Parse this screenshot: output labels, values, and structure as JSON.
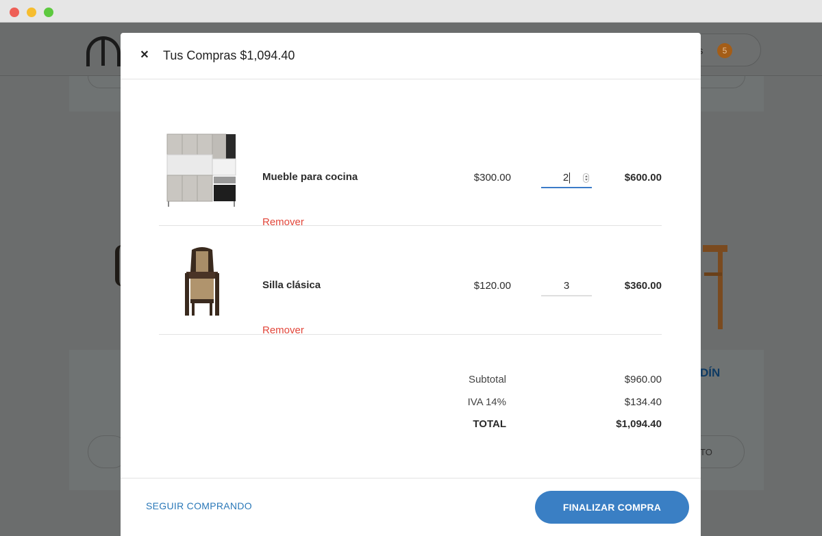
{
  "background": {
    "cart_label_tail": "s",
    "cart_count": "5",
    "section_heading_tail": "DÍN",
    "button_tail": "TO"
  },
  "cart": {
    "title": "Tus Compras",
    "title_total": "$1,094.40",
    "items": [
      {
        "name": "Mueble para cocina",
        "remove_label": "Remover",
        "unit_price": "$300.00",
        "quantity": "2",
        "line_total": "$600.00"
      },
      {
        "name": "Silla clásica",
        "remove_label": "Remover",
        "unit_price": "$120.00",
        "quantity": "3",
        "line_total": "$360.00"
      }
    ],
    "summary": {
      "subtotal_label": "Subtotal",
      "subtotal_value": "$960.00",
      "tax_label": "IVA 14%",
      "tax_value": "$134.40",
      "total_label": "TOTAL",
      "total_value": "$1,094.40"
    },
    "continue_label": "SEGUIR COMPRANDO",
    "checkout_label": "FINALIZAR COMPRA"
  },
  "colors": {
    "accent": "#3a7fc4",
    "link": "#2a78b8",
    "remove": "#e2463a",
    "overlay": "#6b6d6d"
  }
}
